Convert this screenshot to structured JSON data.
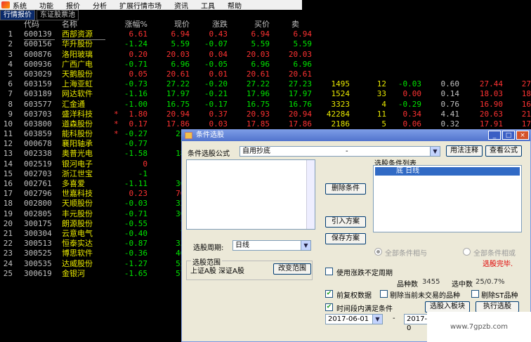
{
  "menu": [
    "系统",
    "功能",
    "报价",
    "分析",
    "扩展行情市场",
    "资讯",
    "工具",
    "帮助"
  ],
  "tabs": [
    "行情报价",
    "东证股票池"
  ],
  "headers": {
    "idx": "",
    "code": "代码",
    "name": "名称",
    "chg": "涨幅%",
    "cur": "现价",
    "amt": "涨跌",
    "bid": "买价",
    "ask": "卖"
  },
  "rows": [
    {
      "i": "1",
      "code": "600139",
      "name": "西部资源",
      "chg": "6.61",
      "cur": "6.94",
      "amt": "0.43",
      "bid": "6.94",
      "ask": "6.94",
      "c": "up",
      "sel": true
    },
    {
      "i": "2",
      "code": "600156",
      "name": "华升股份",
      "chg": "-1.24",
      "cur": "5.59",
      "amt": "-0.07",
      "bid": "5.59",
      "ask": "5.59",
      "c": "dn"
    },
    {
      "i": "3",
      "code": "600876",
      "name": "洛阳玻璃",
      "chg": "0.20",
      "cur": "20.03",
      "amt": "0.04",
      "bid": "20.03",
      "ask": "20.03",
      "c": "up"
    },
    {
      "i": "4",
      "code": "600936",
      "name": "广西广电",
      "chg": "-0.71",
      "cur": "6.96",
      "amt": "-0.05",
      "bid": "6.96",
      "ask": "6.96",
      "c": "dn"
    },
    {
      "i": "5",
      "code": "603029",
      "name": "天鹅股份",
      "chg": "0.05",
      "cur": "20.61",
      "amt": "0.01",
      "bid": "20.61",
      "ask": "20.61",
      "c": "up"
    },
    {
      "i": "6",
      "code": "603159",
      "name": "上海亚虹",
      "chg": "-0.73",
      "cur": "27.22",
      "amt": "-0.20",
      "bid": "27.22",
      "ask": "27.23",
      "vol": "1495",
      "x1": "12",
      "x2": "-0.03",
      "x3": "0.60",
      "x4": "27.44",
      "x5": "27",
      "c": "dn"
    },
    {
      "i": "7",
      "code": "603189",
      "name": "网达软件",
      "chg": "-1.16",
      "cur": "17.97",
      "amt": "-0.21",
      "bid": "17.96",
      "ask": "17.97",
      "vol": "1524",
      "x1": "33",
      "x2": "0.00",
      "x3": "0.14",
      "x4": "18.03",
      "x5": "18",
      "c": "dn"
    },
    {
      "i": "8",
      "code": "603577",
      "name": "汇金通",
      "chg": "-1.00",
      "cur": "16.75",
      "amt": "-0.17",
      "bid": "16.75",
      "ask": "16.76",
      "vol": "3323",
      "x1": "4",
      "x2": "-0.29",
      "x3": "0.76",
      "x4": "16.90",
      "x5": "16",
      "c": "dn"
    },
    {
      "i": "9",
      "code": "603703",
      "name": "盛洋科技",
      "chg": "1.80",
      "cur": "20.94",
      "amt": "0.37",
      "bid": "20.93",
      "ask": "20.94",
      "vol": "42284",
      "x1": "11",
      "x2": "0.34",
      "x3": "4.41",
      "x4": "20.63",
      "x5": "21",
      "c": "up",
      "star": true
    },
    {
      "i": "10",
      "code": "603800",
      "name": "道森股份",
      "chg": "0.17",
      "cur": "17.86",
      "amt": "0.03",
      "bid": "17.85",
      "ask": "17.86",
      "vol": "2186",
      "x1": "5",
      "x2": "0.06",
      "x3": "0.32",
      "x4": "17.91",
      "x5": "17",
      "c": "up",
      "star": true
    },
    {
      "i": "11",
      "code": "603859",
      "name": "能科股份",
      "chg": "-0.27",
      "cur": "22.",
      "amt": "",
      "bid": "",
      "ask": "",
      "c": "dn",
      "star": true
    },
    {
      "i": "12",
      "code": "000678",
      "name": "襄阳轴承",
      "chg": "-0.77",
      "cur": "7.",
      "amt": "",
      "bid": "",
      "ask": "",
      "c": "dn"
    },
    {
      "i": "13",
      "code": "002338",
      "name": "奥普光电",
      "chg": "-1.58",
      "cur": "18.",
      "amt": "",
      "bid": "",
      "ask": "",
      "c": "dn"
    },
    {
      "i": "14",
      "code": "002519",
      "name": "银河电子",
      "chg": "0",
      "cur": "",
      "amt": "",
      "bid": "",
      "ask": "",
      "c": "up"
    },
    {
      "i": "15",
      "code": "002703",
      "name": "浙江世宝",
      "chg": "-1",
      "cur": "",
      "amt": "",
      "bid": "",
      "ask": "",
      "c": "dn"
    },
    {
      "i": "16",
      "code": "002761",
      "name": "多喜爱",
      "chg": "-1.11",
      "cur": "36.",
      "amt": "",
      "bid": "",
      "ask": "",
      "c": "dn"
    },
    {
      "i": "17",
      "code": "002796",
      "name": "世嘉科技",
      "chg": "0.23",
      "cur": "70.",
      "amt": "",
      "bid": "",
      "ask": "",
      "c": "up"
    },
    {
      "i": "18",
      "code": "002800",
      "name": "天顺股份",
      "chg": "-0.03",
      "cur": "32.",
      "amt": "",
      "bid": "",
      "ask": "",
      "c": "dn"
    },
    {
      "i": "19",
      "code": "002805",
      "name": "丰元股份",
      "chg": "-0.71",
      "cur": "30.",
      "amt": "",
      "bid": "",
      "ask": "",
      "c": "dn"
    },
    {
      "i": "20",
      "code": "300175",
      "name": "朗源股份",
      "chg": "-0.55",
      "cur": "7.",
      "amt": "",
      "bid": "",
      "ask": "",
      "c": "dn"
    },
    {
      "i": "21",
      "code": "300304",
      "name": "云意电气",
      "chg": "-0.40",
      "cur": "7.",
      "amt": "",
      "bid": "",
      "ask": "",
      "c": "dn"
    },
    {
      "i": "22",
      "code": "300513",
      "name": "恒泰实达",
      "chg": "-0.87",
      "cur": "33.",
      "amt": "",
      "bid": "",
      "ask": "",
      "c": "dn"
    },
    {
      "i": "23",
      "code": "300525",
      "name": "博思软件",
      "chg": "-0.36",
      "cur": "46.",
      "amt": "",
      "bid": "",
      "ask": "",
      "c": "dn"
    },
    {
      "i": "24",
      "code": "300535",
      "name": "达威股份",
      "chg": "-1.27",
      "cur": "55.",
      "amt": "",
      "bid": "",
      "ask": "",
      "c": "dn"
    },
    {
      "i": "25",
      "code": "300619",
      "name": "金银河",
      "chg": "-1.65",
      "cur": "57.",
      "amt": "",
      "bid": "",
      "ask": "",
      "c": "dn"
    }
  ],
  "dialog": {
    "title": "条件选股",
    "formula_label": "条件选股公式",
    "formula_value": "自用抄底",
    "formula_dash": "-",
    "btn_usage": "用法注释",
    "btn_view": "查看公式",
    "list_header": "选股条件列表",
    "list_item": "底  日线",
    "btn_delete": "删除条件",
    "btn_import": "引入方案",
    "btn_save": "保存方案",
    "radio_and": "全部条件相与",
    "radio_or": "全部条件相或",
    "status": "选股完毕.",
    "period_label": "选股周期:",
    "period_value": "日线",
    "range_title": "选股范围",
    "range_value": "上证A股 深证A股",
    "btn_range": "改变范围",
    "cb_uncertain": "使用涨跌不定周期",
    "count_label": "品种数",
    "count_value": "3455",
    "selected_label": "选中数",
    "selected_value": "25/0.7%",
    "cb_prefix": "前复权数据",
    "cb_exclude_untraded": "剔除当前未交易的品种",
    "cb_exclude_st": "剔除ST品种",
    "cb_time": "时间段内满足条件",
    "btn_to_block": "选股入板块",
    "btn_execute": "执行选股",
    "date_from": "2017-06-01",
    "date_sep": "-",
    "date_to": "2017-0"
  },
  "watermark": "www.7gpzb.com"
}
